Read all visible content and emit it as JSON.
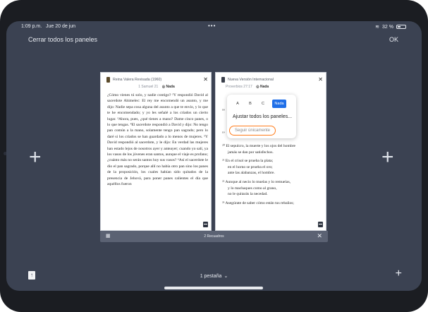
{
  "status": {
    "time": "1:09 p.m.",
    "date": "Jue 20 de jun",
    "dots": "•••",
    "battery": "32 %"
  },
  "toolbar": {
    "close_all": "Cerrar todos los paneles",
    "ok": "OK"
  },
  "left_pane": {
    "version": "Reina Valera Revisada (1960)",
    "reference": "1 Samuel 21",
    "font_label": "Nada",
    "text": "¿Cómo vienes tú solo, y nadie contigo? ²Y respondió David al sacerdote Ahimelec: El rey me encomendó un asunto, y me dijo: Nadie sepa cosa alguna del asunto a que te envío, y lo que te he encomendado; y yo les señalé a los criados un cierto lugar. ³Ahora, pues, ¿qué tienes a mano? Dame cinco panes, o lo que tengas. ⁴El sacerdote respondió a David y dijo: No tengo pan común a la mano, solamente tengo pan sagrado; pero lo daré si los criados se han guardado a lo menos de mujeres. ⁵Y David respondió al sacerdote, y le dijo: En verdad las mujeres han estado lejos de nosotros ayer y anteayer; cuando yo salí, ya los vasos de los jóvenes eran santos, aunque el viaje es profano; ¿cuánto más no serán santos hoy sus vasos? ⁶Así el sacerdote le dio el pan sagrado, porque allí no había otro pan sino los panes de la proposición, los cuales habían sido quitados de la presencia de Jehová, para poner panes calientes el día que aquéllos fueron"
  },
  "right_pane": {
    "version": "Nueva Versión Internacional",
    "reference": "Proverbios 27:17",
    "font_label": "Nada",
    "lines": [
      {
        "text": "6 ...",
        "cls": "partial"
      },
      {
        "text": "⁷ Al...",
        "cls": "partial"
      },
      {
        "text": "...",
        "cls": "partial"
      },
      {
        "text": "...",
        "cls": "partial"
      },
      {
        "text": "²⁰ El sepulcro, la muerte y los ojos del hombre",
        "cls": ""
      },
      {
        "text": "jamás se dan por satisfechos.",
        "cls": "indent"
      },
      {
        "text": "²¹ En el crisol se prueba la plata;",
        "cls": ""
      },
      {
        "text": "en el horno se prueba el oro;",
        "cls": "indent"
      },
      {
        "text": "ante las alabanzas, el hombre.",
        "cls": "indent"
      },
      {
        "text": "²² Aunque al necio lo muelas y lo remuelas,",
        "cls": ""
      },
      {
        "text": "y lo machaques como al grano,",
        "cls": "indent"
      },
      {
        "text": "no le quitarás la necedad.",
        "cls": "indent"
      },
      {
        "text": "²³ Asegúrate de saber cómo están tus rebaños;",
        "cls": ""
      }
    ]
  },
  "popup": {
    "font_a": "A",
    "font_b": "B",
    "font_c": "C",
    "font_none": "Nada",
    "adjust": "Ajustar todos los paneles...",
    "follow": "Seguir únicamente"
  },
  "bottom_strip": {
    "grid_icon": "grid-icon",
    "count": "2 Recuadros",
    "close": "✕"
  },
  "footer": {
    "tabs_label": "1 pestaña",
    "chevron": "⌄",
    "new_plus": "+"
  }
}
